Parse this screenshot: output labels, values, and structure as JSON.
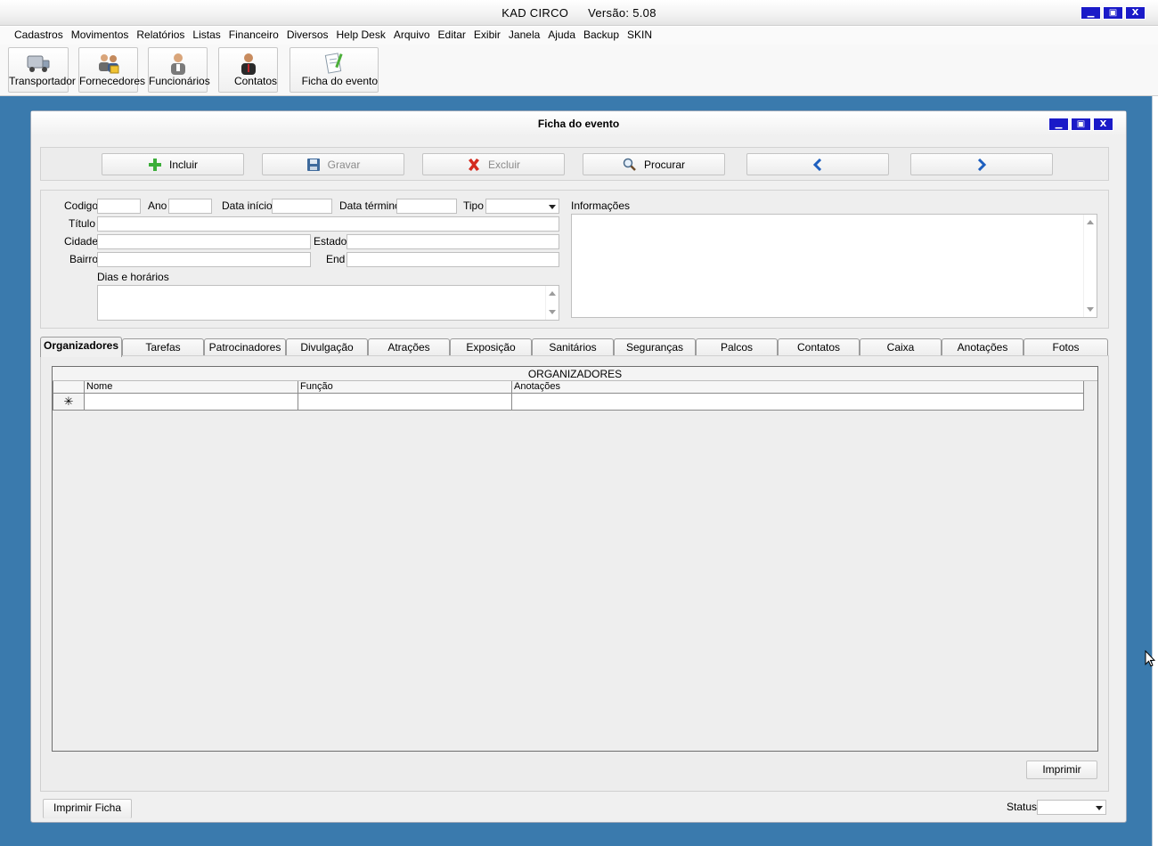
{
  "app": {
    "title": "KAD CIRCO",
    "version": "Versão: 5.08"
  },
  "menu": [
    "Cadastros",
    "Movimentos",
    "Relatórios",
    "Listas",
    "Financeiro",
    "Diversos",
    "Help Desk",
    "Arquivo",
    "Editar",
    "Exibir",
    "Janela",
    "Ajuda",
    "Backup",
    "SKIN"
  ],
  "toolbar": {
    "transportador": "Transportador",
    "fornecedores": "Fornecedores",
    "funcionarios": "Funcionários",
    "contatos": "Contatos",
    "ficha": "Ficha do evento"
  },
  "window": {
    "title": "Ficha do evento",
    "min_icon": "minimize-icon",
    "max_icon": "maximize-icon",
    "close_icon": "close-icon"
  },
  "actions": {
    "incluir": "Incluir",
    "gravar": "Gravar",
    "excluir": "Excluir",
    "procurar": "Procurar"
  },
  "form": {
    "codigo_label": "Codigo",
    "ano_label": "Ano",
    "data_inicio_label": "Data início",
    "data_termino_label": "Data término",
    "tipo_label": "Tipo",
    "titulo_label": "Título",
    "cidade_label": "Cidade",
    "estado_label": "Estado",
    "bairro_label": "Bairro",
    "end_label": "End",
    "dias_label": "Dias e horários",
    "informacoes_label": "Informações",
    "codigo": "",
    "ano": "",
    "data_inicio": "",
    "data_termino": "",
    "tipo": "",
    "titulo": "",
    "cidade": "",
    "estado": "",
    "bairro": "",
    "end": ""
  },
  "tabs": [
    "Organizadores",
    "Tarefas",
    "Patrocinadores",
    "Divulgação",
    "Atrações",
    "Exposição",
    "Sanitários",
    "Seguranças",
    "Palcos",
    "Contatos",
    "Caixa",
    "Anotações",
    "Fotos"
  ],
  "grid": {
    "caption": "ORGANIZADORES",
    "columns": [
      "Nome",
      "Função",
      "Anotações"
    ],
    "new_row_marker": "✳"
  },
  "buttons": {
    "imprimir": "Imprimir",
    "imprimir_ficha": "Imprimir Ficha"
  },
  "status": {
    "label": "Status",
    "value": ""
  },
  "colors": {
    "desktop": "#3a7aad",
    "window_buttons": "#1a1ac8"
  }
}
